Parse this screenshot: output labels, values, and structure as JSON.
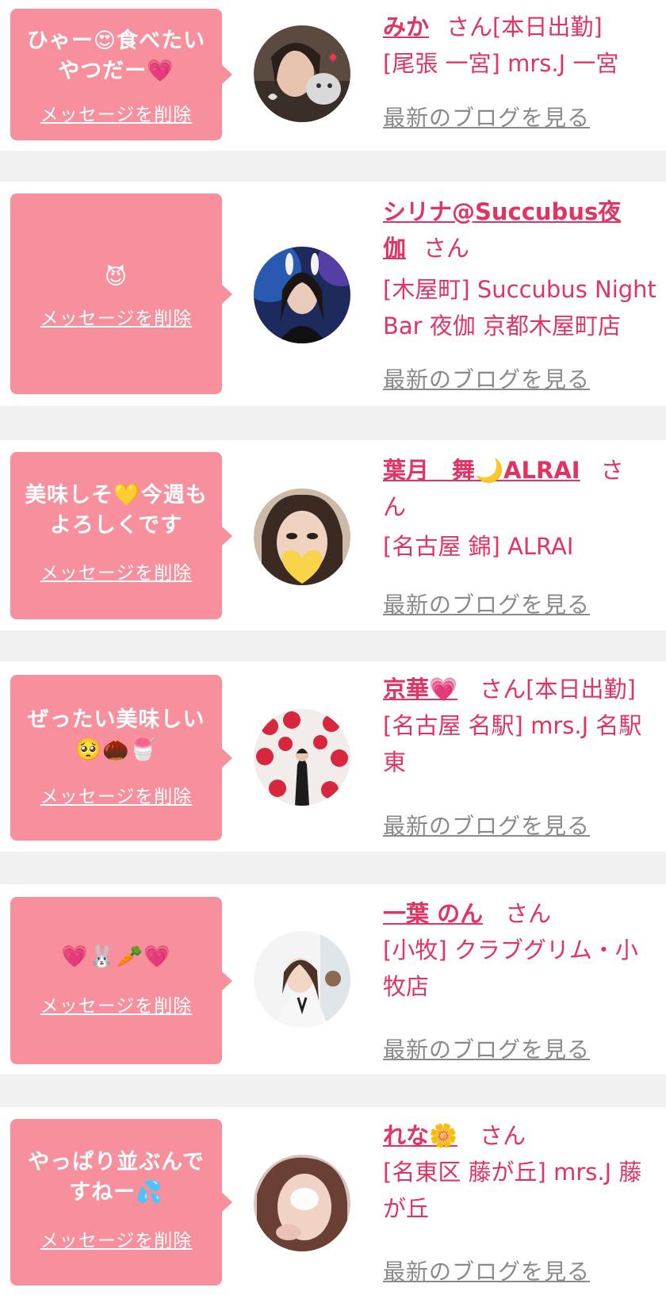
{
  "delete_label": "メッセージを削除",
  "blog_label": "最新のブログを見る",
  "san": "さん",
  "colors": {
    "bubble": "#f7909c",
    "accent": "#e23363",
    "link_gray": "#8a8a8a",
    "background": "#f1f1f1"
  },
  "entries": [
    {
      "message_lines": [
        "ひゃー😍食べたい",
        "やつだー💗"
      ],
      "name": "みか",
      "status": "[本日出勤]",
      "shop_lines": [
        "[尾張 一宮] mrs.J 一宮"
      ]
    },
    {
      "message_lines": [
        "😈"
      ],
      "name_lines": [
        "シリナ@Succubus夜",
        "伽"
      ],
      "status": "",
      "shop_lines": [
        "[木屋町] Succubus Night",
        "Bar 夜伽 京都木屋町店"
      ]
    },
    {
      "message_lines": [
        "美味しそ💛今週も",
        "よろしくです"
      ],
      "name": "葉月　舞🌙ALRAI",
      "status": "",
      "san_split": [
        "さ",
        "ん"
      ],
      "shop_lines": [
        "[名古屋 錦] ALRAI"
      ]
    },
    {
      "message_lines": [
        "ぜったい美味しい",
        "🥺🌰🍧"
      ],
      "name": "京華💗",
      "status": "[本日出勤]",
      "shop_lines": [
        "[名古屋 名駅] mrs.J 名駅",
        "東"
      ]
    },
    {
      "message_lines": [
        "💗🐰🥕💗"
      ],
      "name": "一葉 のん",
      "status": "",
      "shop_lines": [
        "[小牧] クラブグリム・小",
        "牧店"
      ]
    },
    {
      "message_lines": [
        "やっぱり並ぶんで",
        "すねー💦"
      ],
      "name": "れな🌼",
      "status": "",
      "shop_lines": [
        "[名東区 藤が丘] mrs.J 藤",
        "が丘"
      ]
    }
  ]
}
